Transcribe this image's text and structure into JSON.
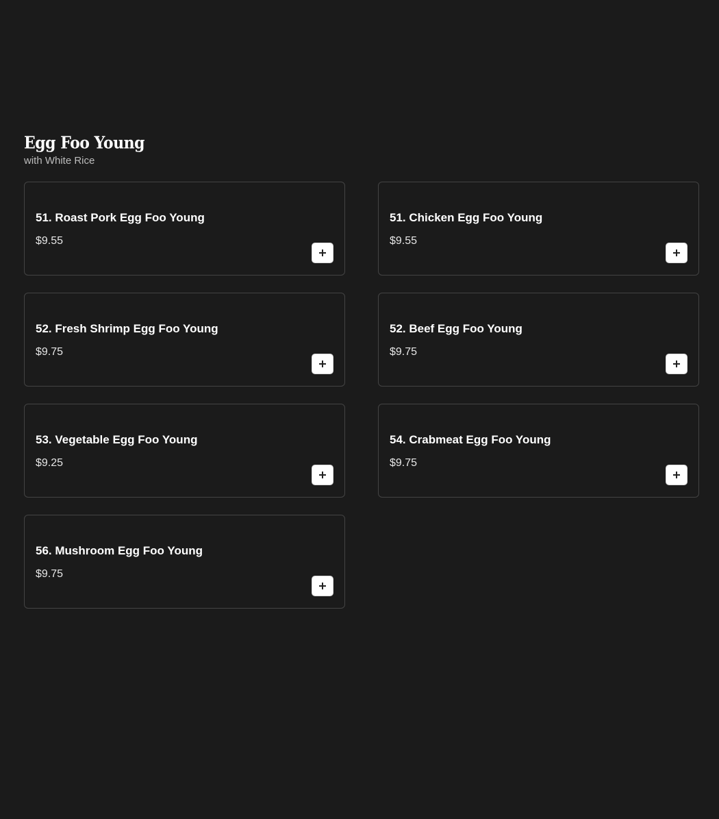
{
  "section": {
    "title": "Egg Foo Young",
    "subtitle": "with White Rice"
  },
  "items": [
    {
      "name": "51. Roast Pork Egg Foo Young",
      "price": "$9.55"
    },
    {
      "name": "51. Chicken Egg Foo Young",
      "price": "$9.55"
    },
    {
      "name": "52. Fresh Shrimp Egg Foo Young",
      "price": "$9.75"
    },
    {
      "name": "52. Beef Egg Foo Young",
      "price": "$9.75"
    },
    {
      "name": "53. Vegetable Egg Foo Young",
      "price": "$9.25"
    },
    {
      "name": "54. Crabmeat Egg Foo Young",
      "price": "$9.75"
    },
    {
      "name": "56. Mushroom Egg Foo Young",
      "price": "$9.75"
    }
  ],
  "icons": {
    "add": "plus-icon"
  },
  "colors": {
    "background": "#1b1b1b",
    "card_border": "#444444",
    "text": "#ffffff",
    "subtitle": "#bdbdbd",
    "button_bg": "#ffffff"
  }
}
